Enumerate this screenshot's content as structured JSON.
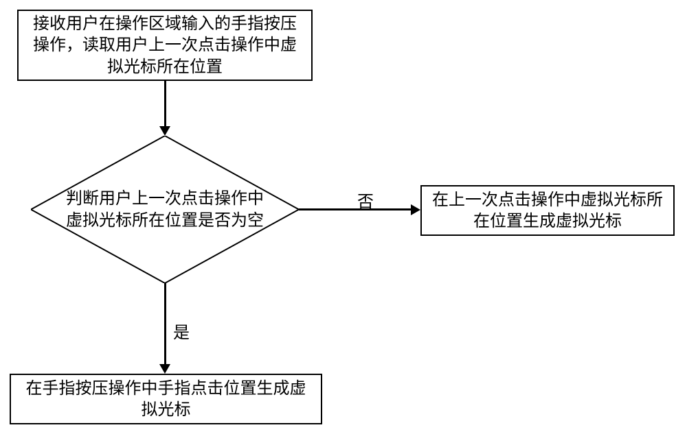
{
  "chart_data": {
    "type": "flowchart",
    "nodes": [
      {
        "id": "A",
        "type": "process",
        "text": "接收用户在操作区域输入的手指按压操作，读取用户上一次点击操作中虚拟光标所在位置"
      },
      {
        "id": "B",
        "type": "decision",
        "text": "判断用户上一次点击操作中虚拟光标所在位置是否为空"
      },
      {
        "id": "C",
        "type": "process",
        "text": "在上一次点击操作中虚拟光标所在位置生成虚拟光标"
      },
      {
        "id": "D",
        "type": "process",
        "text": "在手指按压操作中手指点击位置生成虚拟光标"
      }
    ],
    "edges": [
      {
        "from": "A",
        "to": "B",
        "label": ""
      },
      {
        "from": "B",
        "to": "C",
        "label": "否"
      },
      {
        "from": "B",
        "to": "D",
        "label": "是"
      }
    ]
  },
  "boxA": "接收用户在操作区域输入的手指按压操作，读取用户上一次点击操作中虚拟光标所在位置",
  "diamondB": "判断用户上一次点击操作中虚拟光标所在位置是否为空",
  "boxC": "在上一次点击操作中虚拟光标所在位置生成虚拟光标",
  "boxD": "在手指按压操作中手指点击位置生成虚拟光标",
  "labelNo": "否",
  "labelYes": "是"
}
